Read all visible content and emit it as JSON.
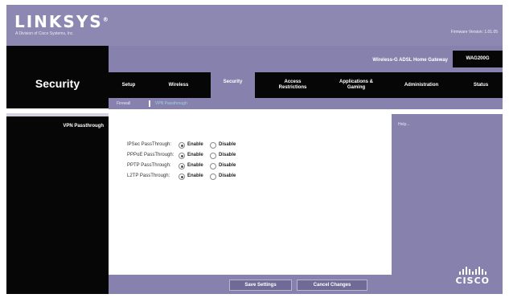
{
  "header": {
    "logo": "LINKSYS",
    "logo_trademark": "®",
    "logo_subtitle": "A Division of Cisco Systems, Inc.",
    "firmware": "Firmware Version: 1.01.05",
    "product_name": "Wireless-G ADSL Home Gateway",
    "model": "WAG200G"
  },
  "section_title": "Security",
  "tabs": [
    {
      "label": "Setup"
    },
    {
      "label": "Wireless"
    },
    {
      "label": "Security",
      "active": true
    },
    {
      "label": "Access Restrictions"
    },
    {
      "label": "Applications & Gaming"
    },
    {
      "label": "Administration"
    },
    {
      "label": "Status"
    }
  ],
  "subtabs": [
    {
      "label": "Firewall"
    },
    {
      "label": "VPN Passthrough",
      "active": true
    }
  ],
  "submenu": {
    "label": "VPN Passthrough"
  },
  "rows": [
    {
      "label": "IPSec PassThrough:",
      "options": [
        "Enable",
        "Disable"
      ],
      "selected": "Enable"
    },
    {
      "label": "PPPoE PassThrough:",
      "options": [
        "Enable",
        "Disable"
      ],
      "selected": "Enable"
    },
    {
      "label": "PPTP PassThrough:",
      "options": [
        "Enable",
        "Disable"
      ],
      "selected": "Enable"
    },
    {
      "label": "L2TP PassThrough:",
      "options": [
        "Enable",
        "Disable"
      ],
      "selected": "Enable"
    }
  ],
  "help": {
    "label": "Help..."
  },
  "buttons": {
    "save": "Save Settings",
    "cancel": "Cancel Changes"
  },
  "brand": {
    "cisco": "CISCO",
    "accent": "#8781ad",
    "dark": "#060606"
  }
}
